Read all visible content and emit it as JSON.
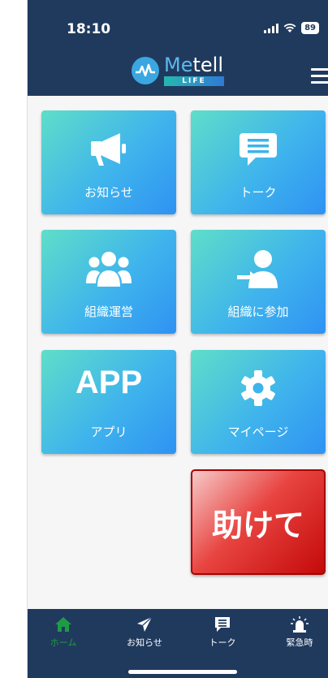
{
  "status_bar": {
    "time": "18:10",
    "battery": "89"
  },
  "header": {
    "logo_name_a": "Me",
    "logo_name_b": "tell",
    "logo_sub": "LIFE"
  },
  "tiles": [
    {
      "label": "お知らせ"
    },
    {
      "label": "トーク"
    },
    {
      "label": "組織運営"
    },
    {
      "label": "組織に参加"
    },
    {
      "label": "アプリ",
      "icon_text": "APP"
    },
    {
      "label": "マイページ"
    }
  ],
  "help_button": {
    "label": "助けて"
  },
  "tabbar": [
    {
      "label": "ホーム",
      "active": true
    },
    {
      "label": "お知らせ"
    },
    {
      "label": "トーク"
    },
    {
      "label": "緊急時"
    }
  ],
  "colors": {
    "header": "#203a5e",
    "tile_start": "#5fdec9",
    "tile_end": "#2f92f3",
    "help": "#e02020",
    "active_tab": "#1f9b46"
  }
}
